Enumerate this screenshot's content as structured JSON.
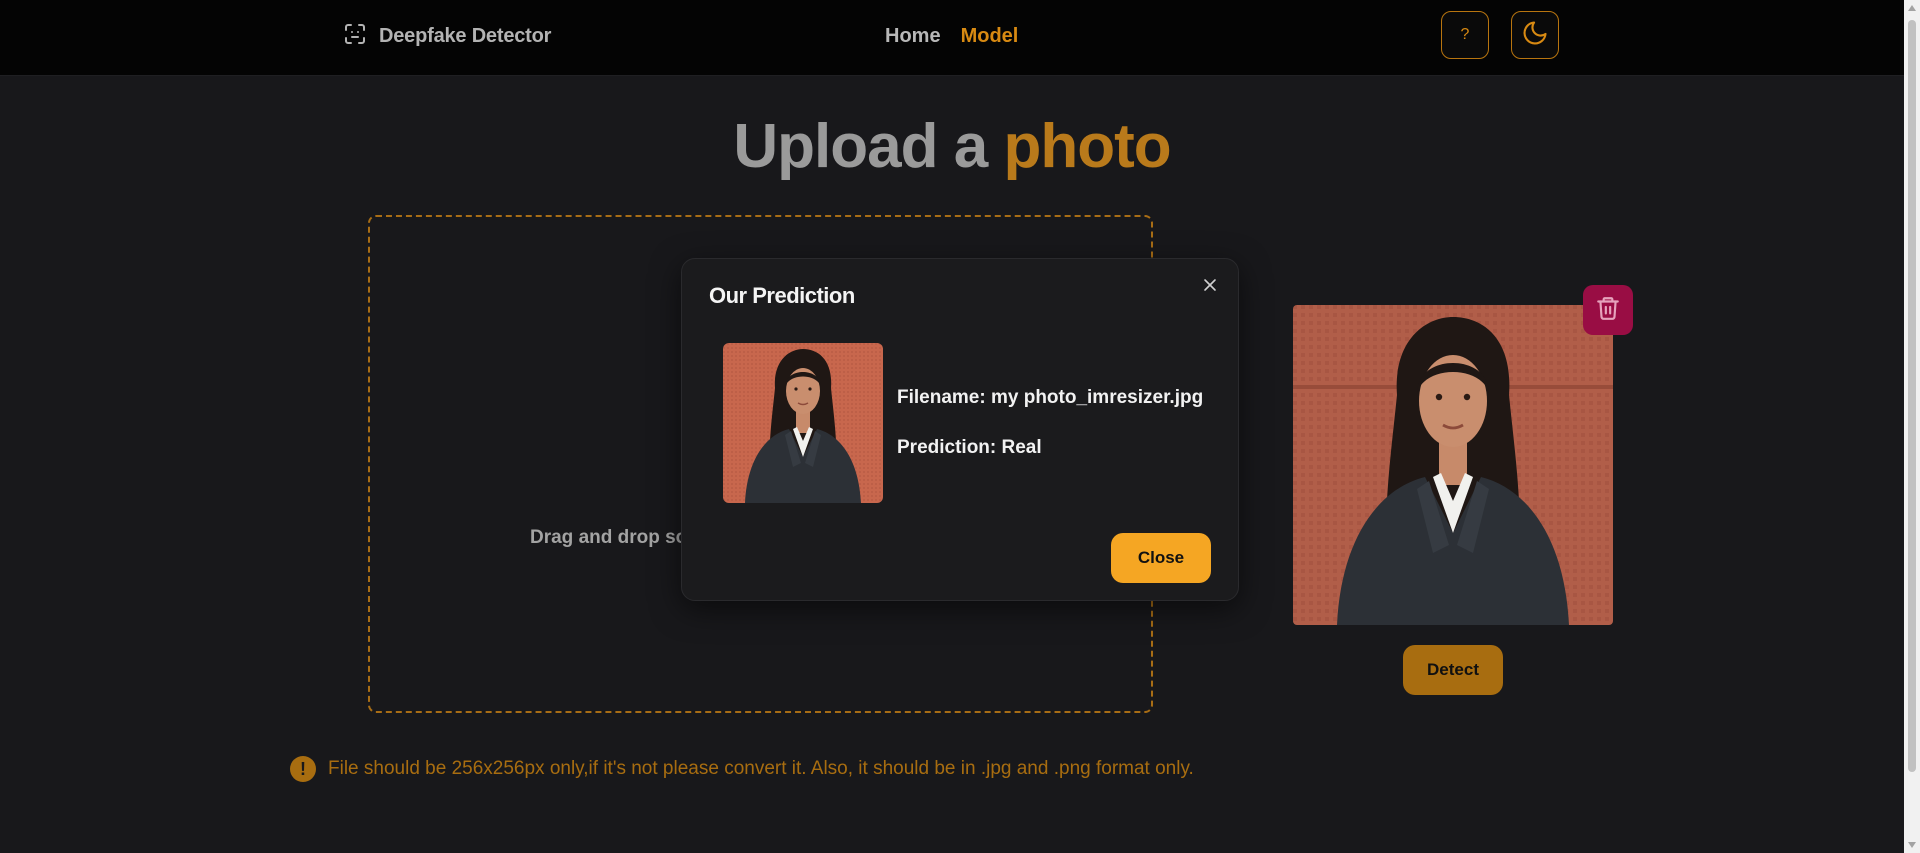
{
  "nav": {
    "brand": "Deepfake Detector",
    "brand_icon": "face-scan-icon",
    "links": [
      "Home",
      "Model"
    ],
    "active_link": "Model",
    "help_label": "?",
    "theme_icon": "moon-icon"
  },
  "hero": {
    "title_part1": "Upload a",
    "title_part2": "photo"
  },
  "dropzone": {
    "text": "Drag and drop so"
  },
  "preview": {
    "delete_icon": "trash-icon",
    "detect_label": "Detect"
  },
  "modal": {
    "title": "Our Prediction",
    "filename_label": "Filename: my photo_imresizer.jpg",
    "prediction_label": "Prediction: Real",
    "close_label": "Close"
  },
  "warning": {
    "icon": "!",
    "text": "File should be 256x256px only,if it's not please convert it. Also, it should be in .jpg and .png format only."
  },
  "colors": {
    "accent": "#d88a12",
    "accent_dim": "#a86d10",
    "close_button": "#f5a623",
    "delete_button": "#990d44",
    "background": "#18181b",
    "navbar": "#040404"
  }
}
